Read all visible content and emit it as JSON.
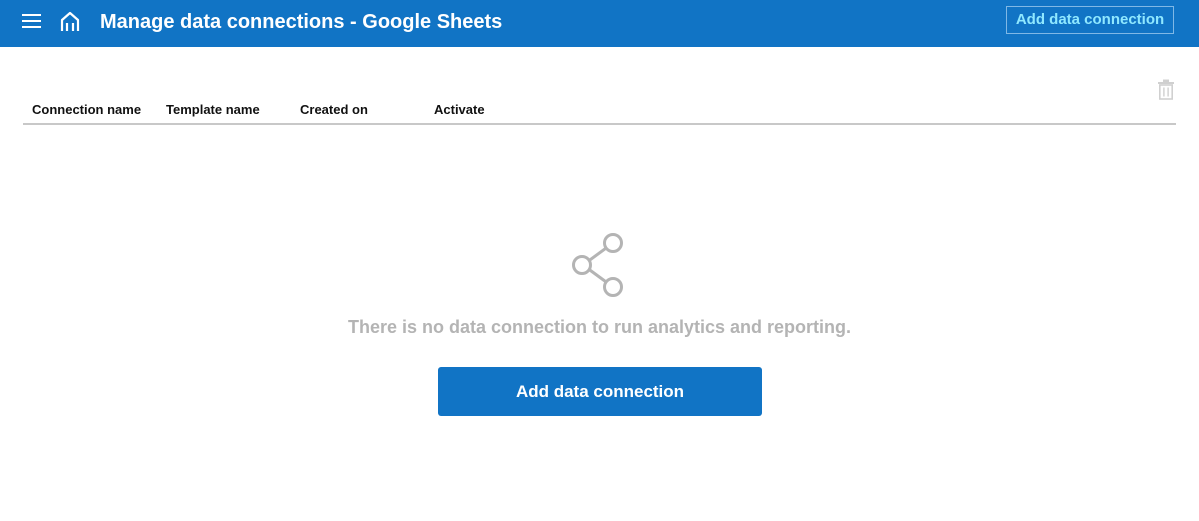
{
  "header": {
    "menu_icon": "hamburger-menu-icon",
    "home_icon": "home-icon",
    "title": "Manage data connections - Google Sheets",
    "add_button_label": "Add data connection"
  },
  "toolbar": {
    "delete_icon": "trash-icon"
  },
  "table": {
    "columns": [
      "Connection name",
      "Template name",
      "Created on",
      "Activate"
    ],
    "rows": []
  },
  "empty_state": {
    "icon": "share-icon",
    "message": "There is no data connection to run analytics and reporting.",
    "button_label": "Add data connection"
  },
  "colors": {
    "header_bg": "#1174c5",
    "accent_text": "#8fe8ff",
    "muted_text": "#b4b4b4",
    "primary_button": "#1174c5"
  }
}
